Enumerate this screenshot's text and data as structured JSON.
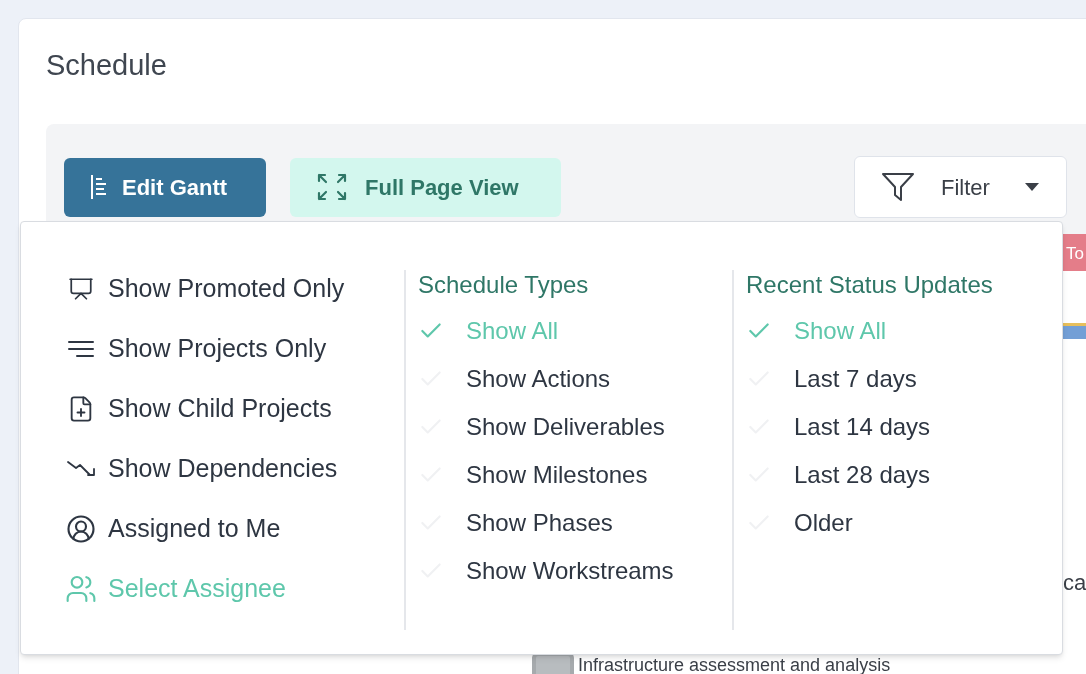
{
  "page": {
    "title": "Schedule"
  },
  "toolbar": {
    "edit_button": "Edit Gantt",
    "full_page_button": "Full Page View",
    "filter": "Filter"
  },
  "filter_menu": {
    "options": [
      {
        "kind": "promoted",
        "label": "Show Promoted Only",
        "selected": false
      },
      {
        "kind": "projects",
        "label": "Show Projects Only",
        "selected": false
      },
      {
        "kind": "child",
        "label": "Show Child Projects",
        "selected": false
      },
      {
        "kind": "dependencies",
        "label": "Show Dependencies",
        "selected": false
      },
      {
        "kind": "me",
        "label": "Assigned to Me",
        "selected": false
      },
      {
        "kind": "assignee",
        "label": "Select Assignee",
        "selected": true
      }
    ],
    "groups": [
      {
        "title": "Schedule Types",
        "items": [
          {
            "label": "Show All",
            "checked": true
          },
          {
            "label": "Show Actions",
            "checked": false
          },
          {
            "label": "Show Deliverables",
            "checked": false
          },
          {
            "label": "Show Milestones",
            "checked": false
          },
          {
            "label": "Show Phases",
            "checked": false
          },
          {
            "label": "Show Workstreams",
            "checked": false
          }
        ]
      },
      {
        "title": "Recent Status Updates",
        "items": [
          {
            "label": "Show All",
            "checked": true
          },
          {
            "label": "Last 7 days",
            "checked": false
          },
          {
            "label": "Last 14 days",
            "checked": false
          },
          {
            "label": "Last 28 days",
            "checked": false
          },
          {
            "label": "Older",
            "checked": false
          }
        ]
      }
    ]
  },
  "gantt": {
    "tag": "To",
    "side_text": "ca",
    "task": "Infrastructure assessment and analysis"
  }
}
